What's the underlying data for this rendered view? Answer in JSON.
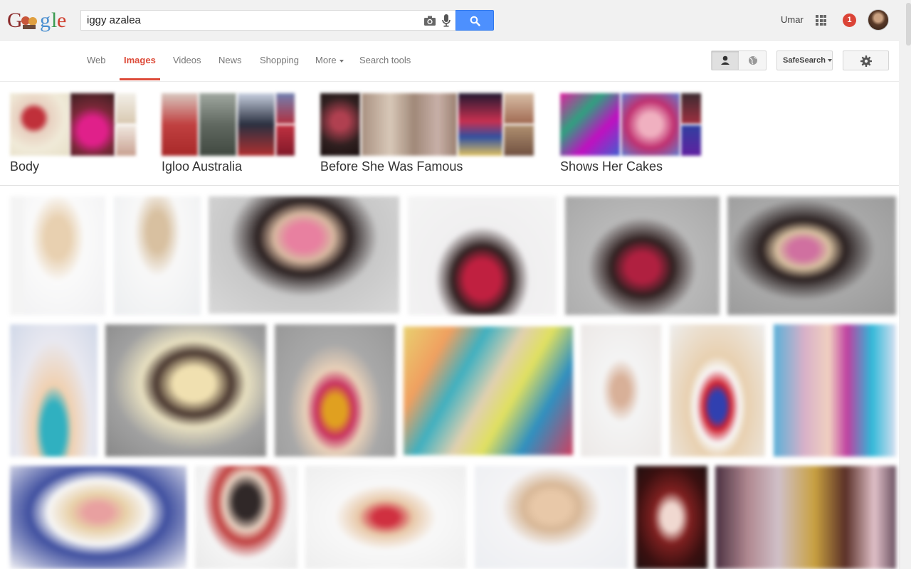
{
  "header": {
    "logo_text": "Google",
    "search": {
      "value": "iggy azalea",
      "placeholder": ""
    },
    "user_name": "Umar",
    "notification_count": "1",
    "icons": [
      "camera-icon",
      "mic-icon",
      "search-icon",
      "apps-grid-icon",
      "avatar"
    ]
  },
  "nav": {
    "tabs": [
      "Web",
      "Images",
      "Videos",
      "News",
      "Shopping",
      "More",
      "Search tools"
    ],
    "active_tab": "Images",
    "safesearch_label": "SafeSearch",
    "icons": [
      "person-icon",
      "globe-icon",
      "gear-icon"
    ]
  },
  "related": [
    {
      "label": "Body"
    },
    {
      "label": "Igloo Australia"
    },
    {
      "label": "Before She Was Famous"
    },
    {
      "label": "Shows Her Cakes"
    }
  ],
  "colors": {
    "accent_red": "#dd4b39",
    "search_blue": "#4d90fe",
    "topbar_bg": "#f1f1f1"
  }
}
